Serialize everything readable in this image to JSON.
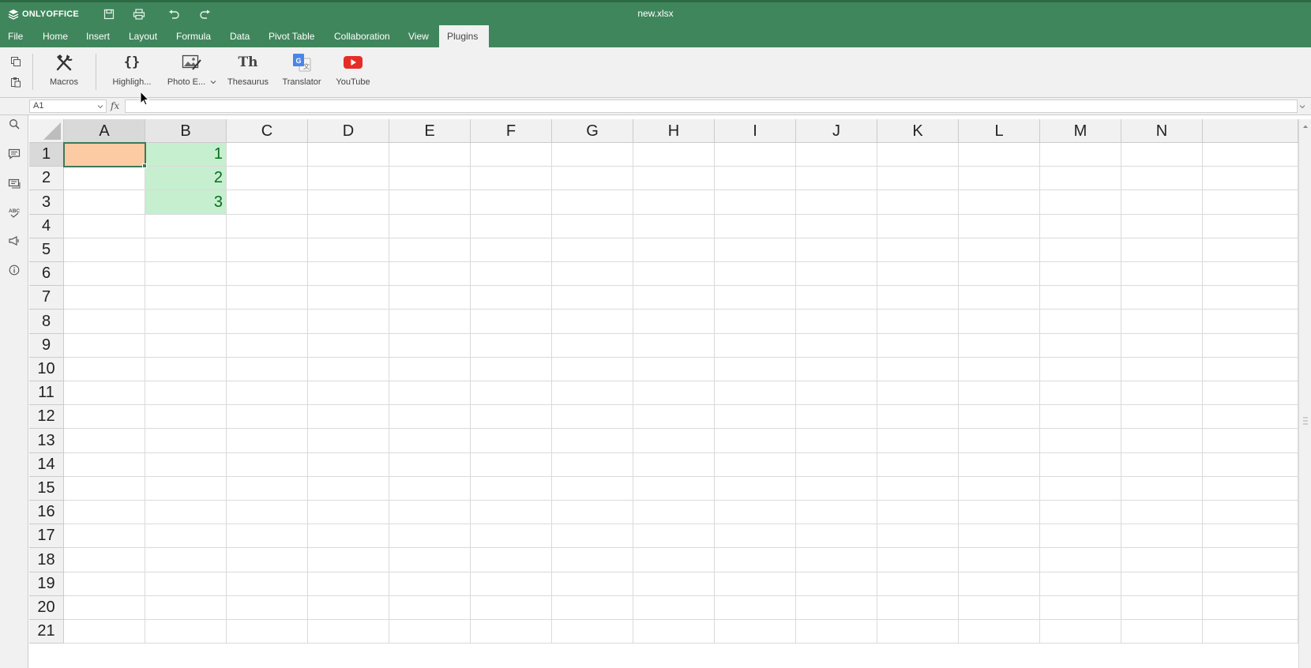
{
  "app": {
    "brand": "ONLYOFFICE",
    "document_title": "new.xlsx"
  },
  "quick_access": {
    "save": "save-icon",
    "print": "print-icon",
    "undo": "undo-icon",
    "redo": "redo-icon"
  },
  "menu_tabs": [
    {
      "label": "File"
    },
    {
      "label": "Home"
    },
    {
      "label": "Insert"
    },
    {
      "label": "Layout"
    },
    {
      "label": "Formula"
    },
    {
      "label": "Data"
    },
    {
      "label": "Pivot Table"
    },
    {
      "label": "Collaboration"
    },
    {
      "label": "View"
    },
    {
      "label": "Plugins",
      "active": true
    }
  ],
  "toolbar": {
    "macros": "Macros",
    "highlight": "Highligh...",
    "photo_editor": "Photo E...",
    "thesaurus": "Thesaurus",
    "thesaurus_glyph": "Th",
    "translator": "Translator",
    "youtube": "YouTube"
  },
  "formula_bar": {
    "name_box": "A1",
    "fx": "fx",
    "formula": ""
  },
  "sheet": {
    "columns": [
      "A",
      "B",
      "C",
      "D",
      "E",
      "F",
      "G",
      "H",
      "I",
      "J",
      "K",
      "L",
      "M",
      "N"
    ],
    "rows": [
      "1",
      "2",
      "3",
      "4",
      "5",
      "6",
      "7",
      "8",
      "9",
      "10",
      "11",
      "12",
      "13",
      "14",
      "15",
      "16",
      "17",
      "18",
      "19",
      "20",
      "21"
    ],
    "cells": {
      "B1": "1",
      "B2": "2",
      "B3": "3"
    }
  },
  "colors": {
    "brand_green": "#40865c",
    "selection_orange": "#fccba4",
    "highlight_green": "#c5efcf",
    "youtube_red": "#e52d27",
    "translator_blue": "#4a86e8"
  }
}
